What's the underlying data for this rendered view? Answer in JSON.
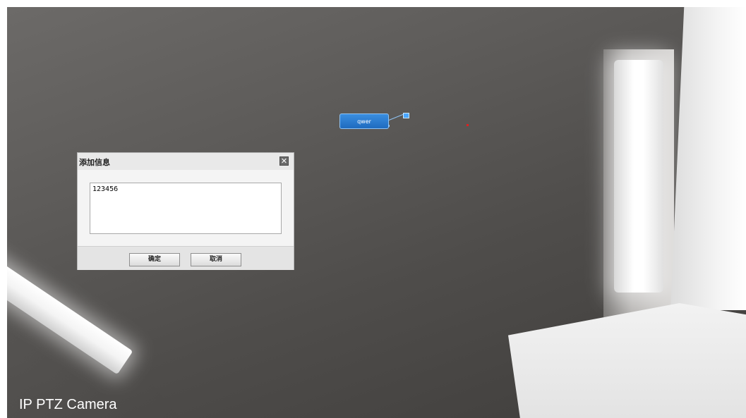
{
  "overlay_tag": {
    "label": "qwer"
  },
  "dialog": {
    "title": "添加信息",
    "close_glyph": "✕",
    "textarea_value": "123456",
    "ok_label": "确定",
    "cancel_label": "取消"
  },
  "camera": {
    "label": "IP PTZ Camera"
  },
  "colors": {
    "tag_fill": "#1f6bbf",
    "tag_border": "#8fc3f3",
    "marker": "#e02020",
    "dialog_bg": "#e9e9e9"
  },
  "icons": {
    "close": "close-icon"
  }
}
